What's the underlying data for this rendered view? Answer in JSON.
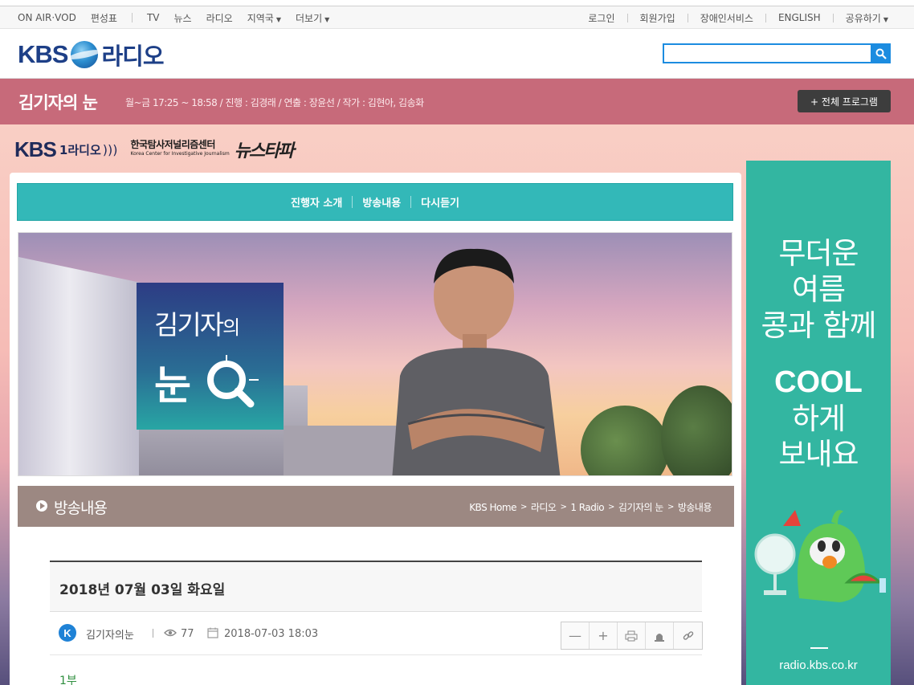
{
  "topnav": {
    "left": [
      "ON AIR·VOD",
      "편성표",
      "TV",
      "뉴스",
      "라디오",
      "지역국",
      "더보기"
    ],
    "right": [
      "로그인",
      "회원가입",
      "장애인서비스",
      "ENGLISH",
      "공유하기"
    ]
  },
  "header": {
    "logo_kbs": "KBS",
    "logo_radio": "라디오",
    "search_value": ""
  },
  "program": {
    "title": "김기자의 눈",
    "info": "월~금 17:25 ~ 18:58 / 진행 : 김경래 / 연출 : 장윤선 / 작가 : 김현아, 김송화",
    "all_button": "+ 전체 프로그램"
  },
  "brand": {
    "kbs": "KBS",
    "one_radio": "1라디오",
    "kcij": "한국탐사저널리즘센터",
    "kcij_en": "Korea Center for Investigative Journalism",
    "newstapa": "뉴스타파"
  },
  "tabs": [
    "진행자 소개",
    "방송내용",
    "다시듣기"
  ],
  "banner": {
    "card_line1": "김기자",
    "card_line1b": "의",
    "card_line2": "눈"
  },
  "section": {
    "title": "방송내용",
    "breadcrumb": [
      "KBS Home",
      "라디오",
      "1 Radio",
      "김기자의 눈",
      "방송내용"
    ]
  },
  "article": {
    "date_title": "2018년 07월 03일 화요일",
    "author_initial": "K",
    "author": "김기자의눈",
    "views": "77",
    "datetime": "2018-07-03 18:03",
    "part": "1부"
  },
  "ad": {
    "line1": "무더운",
    "line2": "여름",
    "line3": "콩과 함께",
    "line4": "COOL",
    "line5": "하게",
    "line6": "보내요",
    "url": "radio.kbs.co.kr"
  },
  "colors": {
    "program_bar": "#c76a7a",
    "tab_bar": "#33b8b8",
    "section_bar": "#9c8882",
    "ad_bg": "#33b6a1",
    "brand_blue": "#1d3f87",
    "search_blue": "#1c8ce0"
  }
}
